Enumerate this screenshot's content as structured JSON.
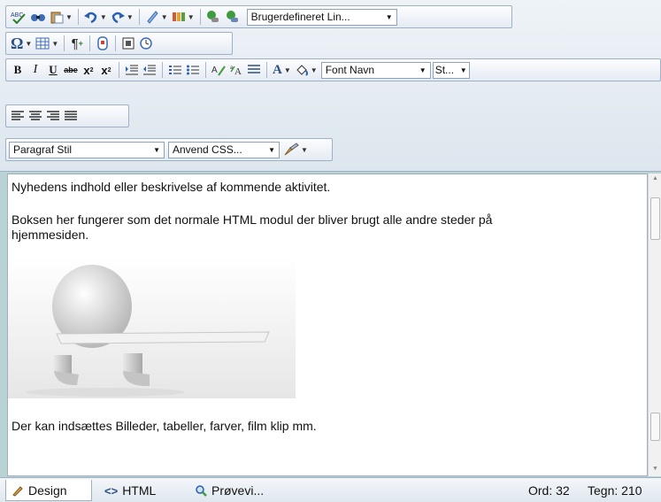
{
  "toolbar": {
    "row1": {
      "link_dropdown": "Brugerdefineret Lin..."
    },
    "row2": {},
    "row3": {
      "font_dropdown": "Font Navn",
      "size_dropdown": "St..."
    },
    "row4": {},
    "row5": {
      "paragraph_dropdown": "Paragraf Stil",
      "css_dropdown": "Anvend CSS..."
    }
  },
  "content": {
    "paragraph1": "Nyhedens indhold eller beskrivelse af kommende aktivitet.",
    "paragraph2_line1": "Boksen her fungerer som det normale HTML modul der bliver brugt alle andre steder på",
    "paragraph2_line2": "hjemmesiden.",
    "paragraph3": "Der kan indsættes Billeder, tabeller, farver, film klip mm."
  },
  "bottombar": {
    "tab_design": "Design",
    "tab_html": "HTML",
    "tab_preview": "Prøvevi...",
    "word_count": "Ord: 32",
    "char_count": "Tegn: 210"
  },
  "colors": {
    "page_background": "#b9d2d3",
    "toolbar_text": "#2b4f84"
  }
}
